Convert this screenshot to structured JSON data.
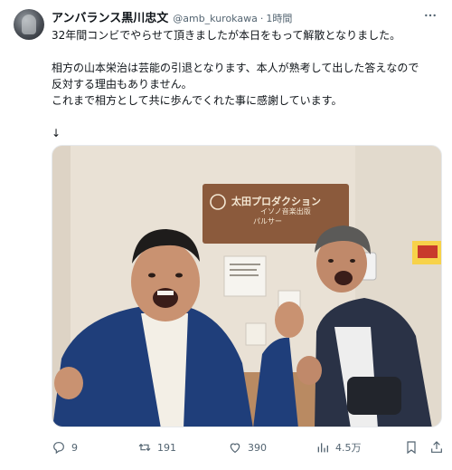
{
  "author": {
    "name": "アンバランス黒川忠文",
    "handle": "@amb_kurokawa",
    "separator": "·",
    "time": "1時間"
  },
  "tweet": {
    "lines": [
      "32年間コンビでやらせて頂きましたが本日をもって解散となりました。",
      "",
      "相方の山本栄治は芸能の引退となります、本人が熟考して出した答えなので",
      "反対する理由もありません。",
      "これまで相方として共に歩んでくれた事に感謝しています。",
      "",
      "↓"
    ]
  },
  "media": {
    "sign_title": "太田プロダクション",
    "sign_line1": "イソノ音楽出版",
    "sign_line2": "パルサー"
  },
  "actions": {
    "reply_count": "9",
    "retweet_count": "191",
    "like_count": "390",
    "views_count": "4.5万"
  },
  "icons": {
    "reply": "reply-icon",
    "retweet": "retweet-icon",
    "like": "heart-icon",
    "views": "views-icon",
    "bookmark": "bookmark-icon",
    "share": "share-icon",
    "more": "more-icon"
  },
  "colors": {
    "text": "#0f1419",
    "muted": "#536471",
    "sign_brown": "#8b5a3c"
  }
}
